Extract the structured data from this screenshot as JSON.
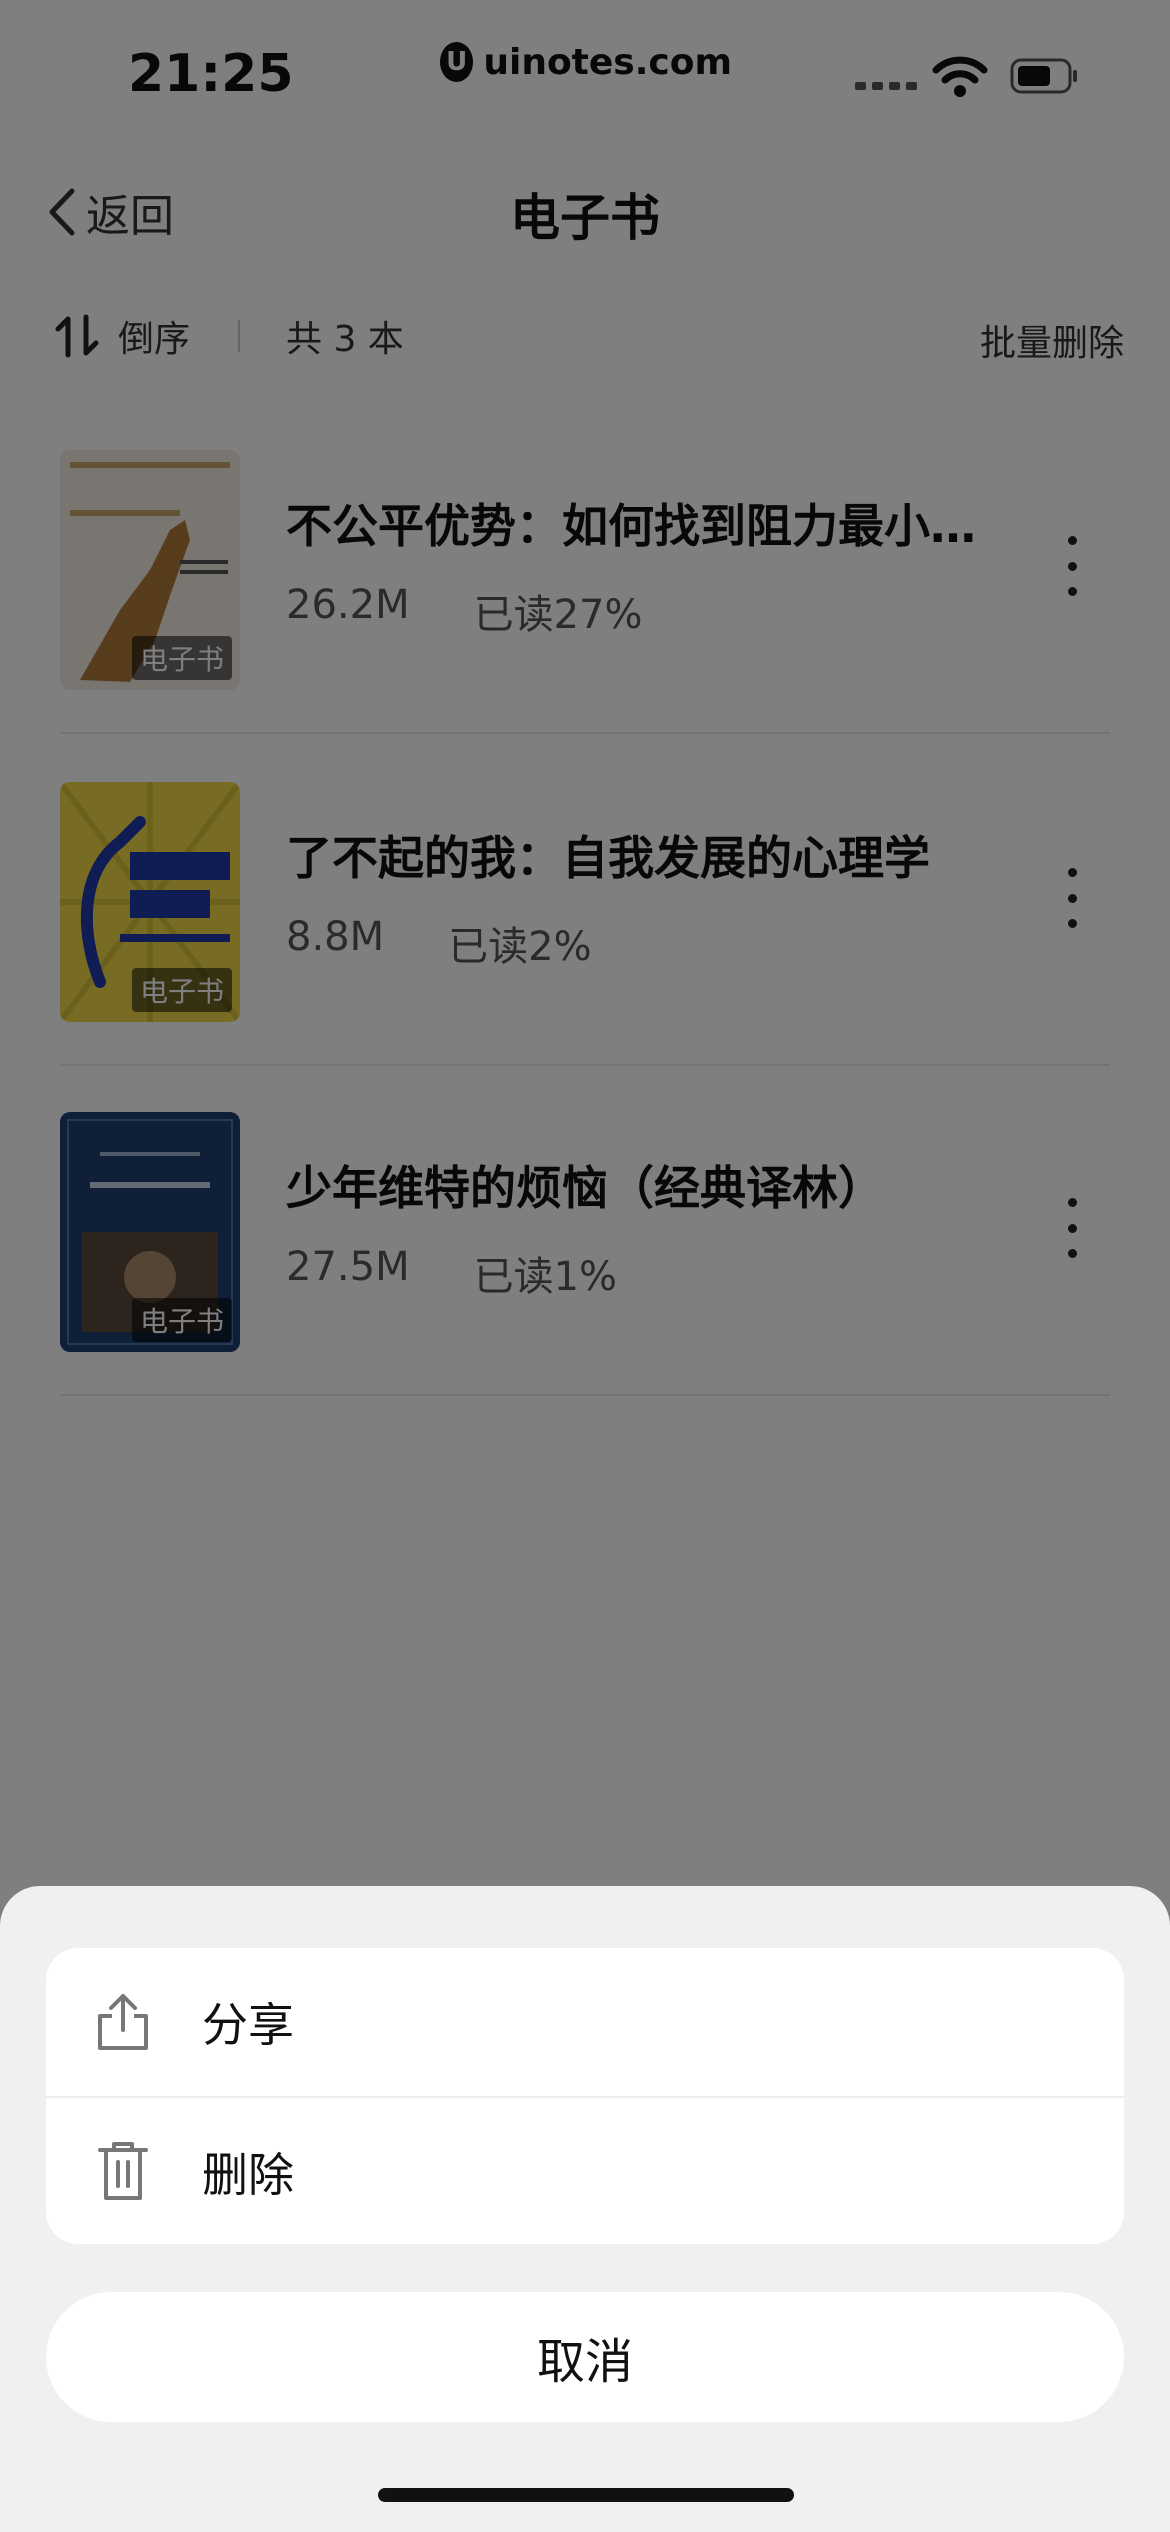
{
  "status_bar": {
    "time": "21:25",
    "url": "uinotes.com",
    "logo_glyph": "U"
  },
  "nav": {
    "back_label": "返回",
    "title": "电子书"
  },
  "toolbar": {
    "sort_label": "倒序",
    "count_label": "共 3 本",
    "batch_delete_label": "批量删除"
  },
  "books": [
    {
      "title": "不公平优势：如何找到阻力最小的成功路径",
      "size": "26.2M",
      "progress": "已读27%",
      "badge": "电子书",
      "cover_color": "#f3ede2"
    },
    {
      "title": "了不起的我：自我发展的心理学",
      "size": "8.8M",
      "progress": "已读2%",
      "badge": "电子书",
      "cover_color": "#f0d94a"
    },
    {
      "title": "少年维特的烦恼（经典译林）",
      "size": "27.5M",
      "progress": "已读1%",
      "badge": "电子书",
      "cover_color": "#1d3f6e"
    }
  ],
  "action_sheet": {
    "actions": [
      {
        "label": "分享",
        "icon": "share-icon"
      },
      {
        "label": "删除",
        "icon": "trash-icon"
      }
    ],
    "cancel_label": "取消"
  }
}
